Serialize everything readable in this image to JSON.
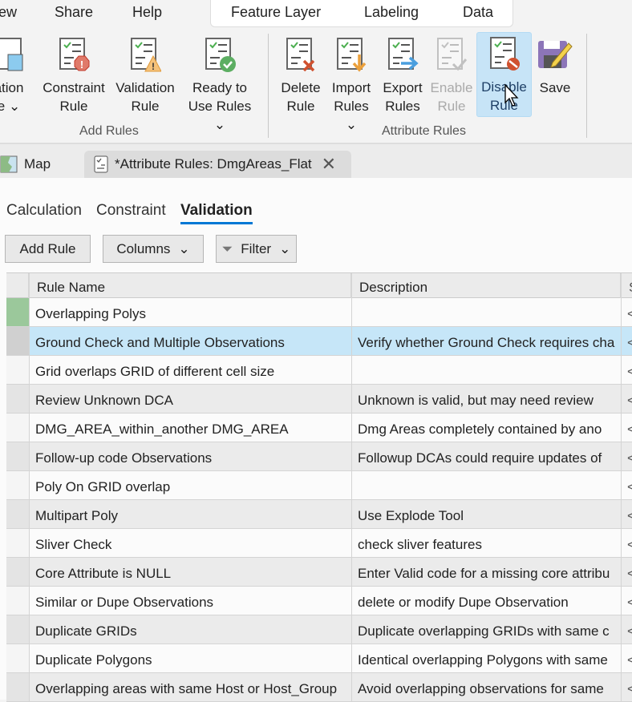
{
  "ribbon_tabs": [
    "ew",
    "Share",
    "Help"
  ],
  "context_tabs": [
    "Feature Layer",
    "Labeling",
    "Data"
  ],
  "add_rules": {
    "group_label": "Add Rules",
    "buttons": [
      {
        "l1": "ation",
        "l2": "e ⌄",
        "icon": "calculation-rule-icon"
      },
      {
        "l1": "Constraint",
        "l2": "Rule",
        "icon": "constraint-rule-icon"
      },
      {
        "l1": "Validation",
        "l2": "Rule",
        "icon": "validation-rule-icon"
      },
      {
        "l1": "Ready to",
        "l2": "Use Rules ⌄",
        "icon": "ready-to-use-rules-icon"
      }
    ]
  },
  "attribute_rules": {
    "group_label": "Attribute Rules",
    "buttons": [
      {
        "l1": "Delete",
        "l2": "Rule"
      },
      {
        "l1": "Import",
        "l2": "Rules ⌄"
      },
      {
        "l1": "Export",
        "l2": "Rules"
      },
      {
        "l1": "Enable",
        "l2": "Rule"
      },
      {
        "l1": "Disable",
        "l2": "Rule"
      },
      {
        "l1": "Save",
        "l2": ""
      }
    ]
  },
  "doc_tabs": {
    "map": "Map",
    "active": "*Attribute Rules: DmgAreas_Flat"
  },
  "sub_tabs": [
    "Calculation",
    "Constraint",
    "Validation"
  ],
  "toolbar": {
    "add_rule": "Add Rule",
    "columns": "Columns",
    "filter": "Filter"
  },
  "columns": [
    "Rule Name",
    "Description",
    "S"
  ],
  "rows": [
    {
      "name": "Overlapping Polys",
      "desc": "",
      "c3": "<"
    },
    {
      "name": "Ground Check and Multiple Observations",
      "desc": "Verify whether Ground Check requires cha",
      "c3": "<"
    },
    {
      "name": "Grid overlaps  GRID of different cell size",
      "desc": "",
      "c3": "<"
    },
    {
      "name": "Review Unknown DCA",
      "desc": "Unknown is valid, but may need review",
      "c3": "<"
    },
    {
      "name": "DMG_AREA_within_another DMG_AREA",
      "desc": "Dmg Areas completely contained by ano",
      "c3": "<"
    },
    {
      "name": "Follow-up code Observations",
      "desc": "Followup DCAs could require updates of",
      "c3": "<"
    },
    {
      "name": "Poly On GRID overlap",
      "desc": "",
      "c3": "<"
    },
    {
      "name": "Multipart Poly",
      "desc": "Use Explode Tool",
      "c3": "<"
    },
    {
      "name": "Sliver Check",
      "desc": "check sliver features",
      "c3": "<"
    },
    {
      "name": "Core Attribute is NULL",
      "desc": "Enter Valid code for a missing core attribu",
      "c3": "<"
    },
    {
      "name": "Similar or Dupe Observations",
      "desc": "delete or modify Dupe Observation",
      "c3": "<"
    },
    {
      "name": "Duplicate GRIDs",
      "desc": "Duplicate overlapping GRIDs with same c",
      "c3": "<"
    },
    {
      "name": "Duplicate Polygons",
      "desc": "Identical overlapping Polygons with same",
      "c3": "<"
    },
    {
      "name": "Overlapping areas with same Host or Host_Group",
      "desc": "Avoid overlapping observations for same",
      "c3": "<"
    }
  ],
  "colors": {
    "accent": "#0078d4",
    "selected_row": "#c6e6f8",
    "hover_button": "#c7e4f7"
  }
}
